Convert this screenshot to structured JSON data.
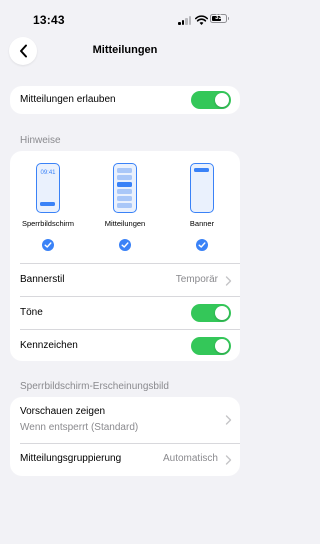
{
  "status": {
    "time": "13:43",
    "battery": "33"
  },
  "nav": {
    "title": "Mitteilungen"
  },
  "allow": {
    "label": "Mitteilungen erlauben",
    "on": true
  },
  "hints": {
    "header": "Hinweise",
    "styles": [
      {
        "label": "Sperrbildschirm",
        "preview_time": "09:41",
        "selected": true
      },
      {
        "label": "Mitteilungen",
        "selected": true
      },
      {
        "label": "Banner",
        "selected": true
      }
    ],
    "banner_style": {
      "label": "Bannerstil",
      "value": "Temporär"
    },
    "sounds": {
      "label": "Töne",
      "on": true
    },
    "badges": {
      "label": "Kennzeichen",
      "on": true
    }
  },
  "lockscreen": {
    "header": "Sperrbildschirm-Erscheinungsbild",
    "previews": {
      "label": "Vorschauen zeigen",
      "sublabel": "Wenn entsperrt (Standard)"
    },
    "grouping": {
      "label": "Mitteilungsgruppierung",
      "value": "Automatisch"
    }
  },
  "colors": {
    "accent": "#3a82f7",
    "toggle_on": "#34c759",
    "background": "#f2f2f6",
    "secondary_text": "#8a8a8e"
  }
}
